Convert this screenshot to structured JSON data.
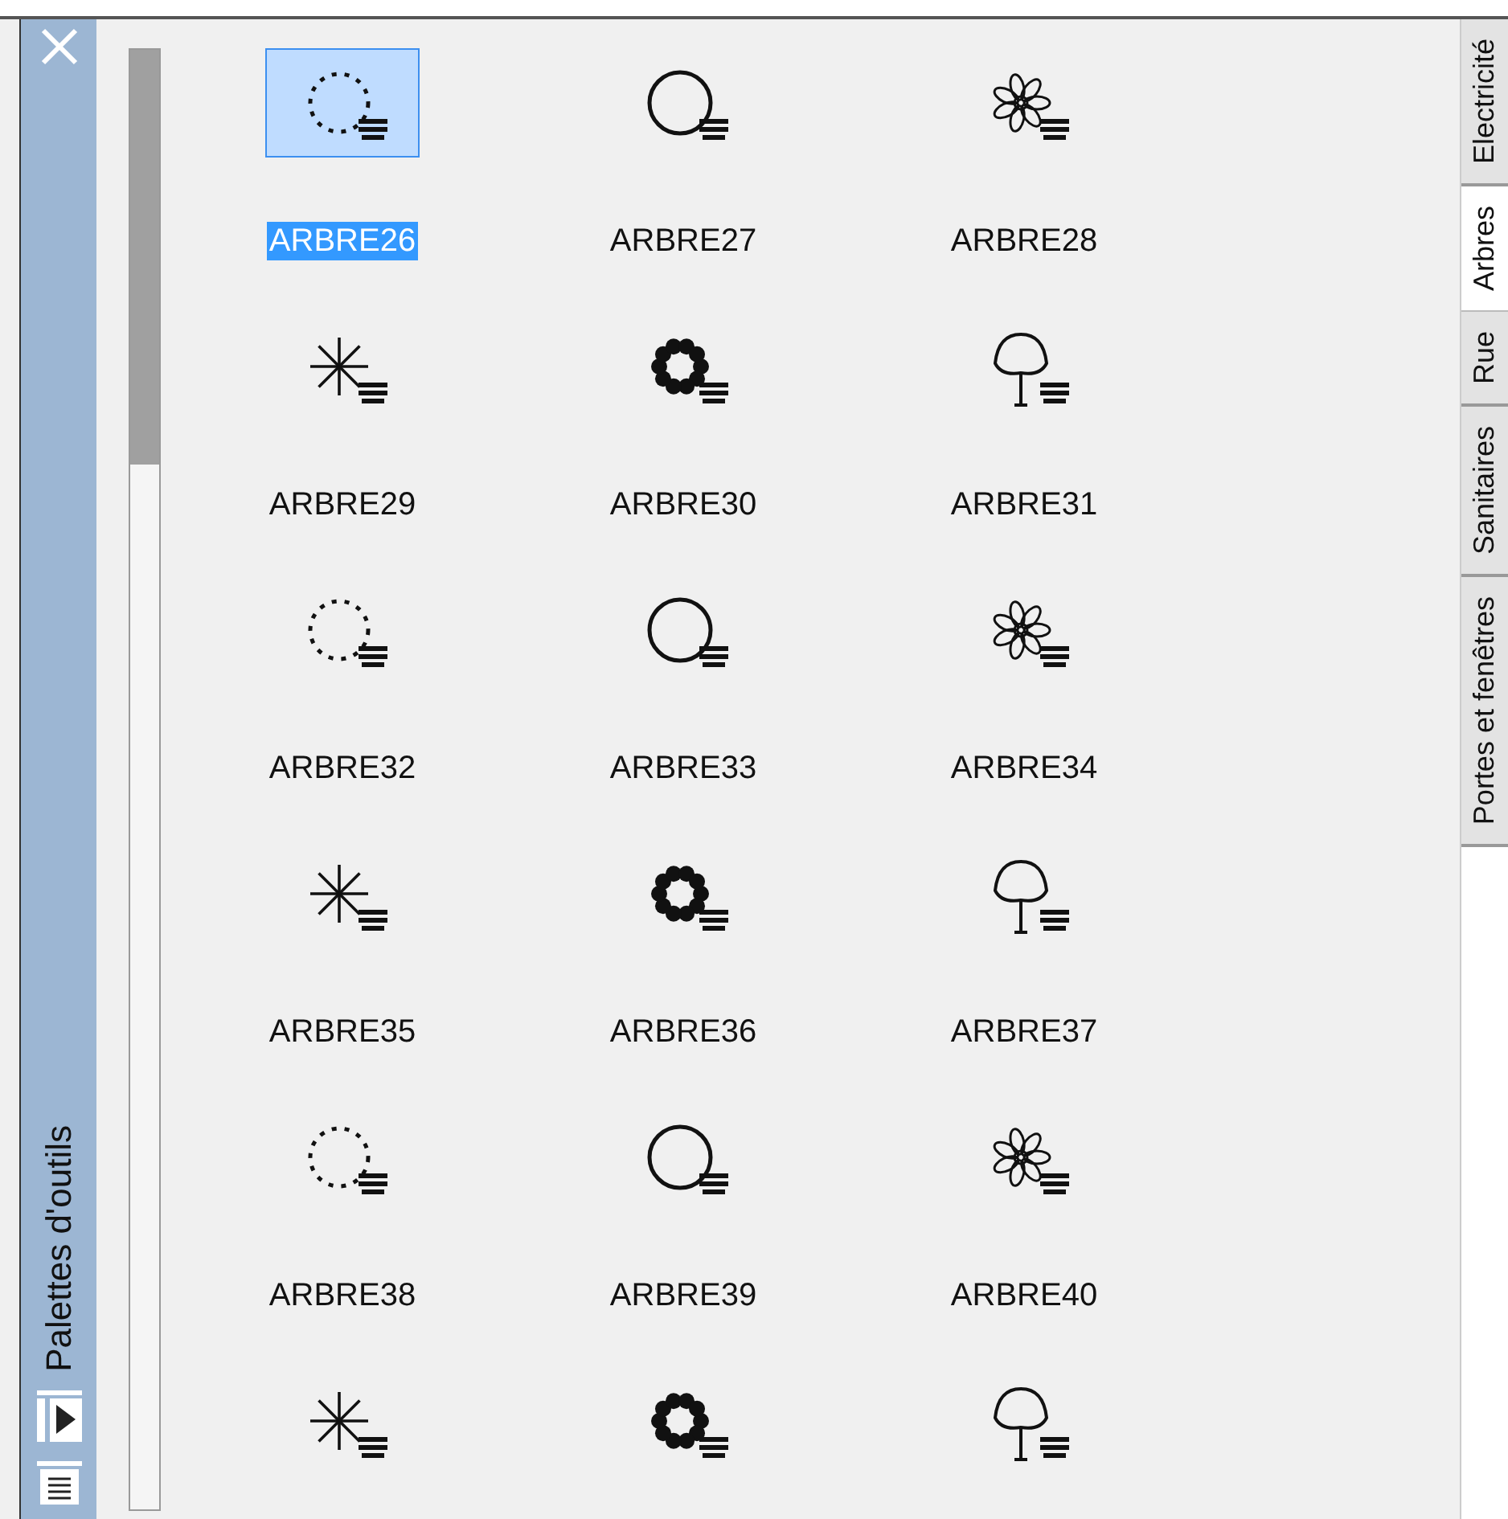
{
  "palette": {
    "title": "Palettes d'outils",
    "items": [
      {
        "label": "ARBRE26",
        "selected": true
      },
      {
        "label": "ARBRE27",
        "selected": false
      },
      {
        "label": "ARBRE28",
        "selected": false
      },
      {
        "label": "ARBRE29",
        "selected": false
      },
      {
        "label": "ARBRE30",
        "selected": false
      },
      {
        "label": "ARBRE31",
        "selected": false
      },
      {
        "label": "ARBRE32",
        "selected": false
      },
      {
        "label": "ARBRE33",
        "selected": false
      },
      {
        "label": "ARBRE34",
        "selected": false
      },
      {
        "label": "ARBRE35",
        "selected": false
      },
      {
        "label": "ARBRE36",
        "selected": false
      },
      {
        "label": "ARBRE37",
        "selected": false
      },
      {
        "label": "ARBRE38",
        "selected": false
      },
      {
        "label": "ARBRE39",
        "selected": false
      },
      {
        "label": "ARBRE40",
        "selected": false
      },
      {
        "selected": false
      },
      {
        "selected": false
      },
      {
        "selected": false
      }
    ],
    "tabs": [
      {
        "label": "Electricité",
        "selected": false
      },
      {
        "label": "Arbres",
        "selected": true
      },
      {
        "label": "Rue",
        "selected": false
      },
      {
        "label": "Sanitaires",
        "selected": false
      },
      {
        "label": "Portes et fenêtres",
        "selected": false
      }
    ]
  }
}
